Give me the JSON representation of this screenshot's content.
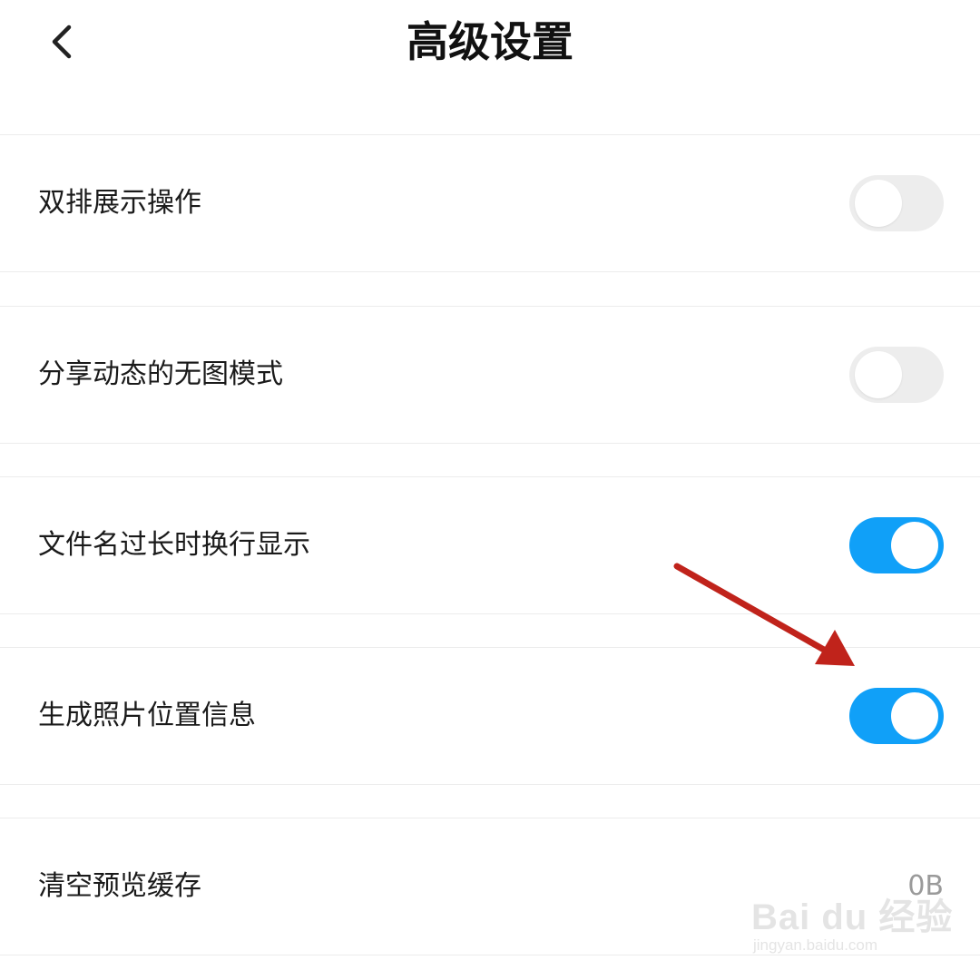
{
  "header": {
    "title": "高级设置",
    "back_icon": "chevron-left-icon"
  },
  "settings": [
    {
      "label": "双排展示操作",
      "type": "toggle",
      "state": "off"
    },
    {
      "label": "分享动态的无图模式",
      "type": "toggle",
      "state": "off"
    },
    {
      "label": "文件名过长时换行显示",
      "type": "toggle",
      "state": "on"
    },
    {
      "label": "生成照片位置信息",
      "type": "toggle",
      "state": "on"
    },
    {
      "label": "清空预览缓存",
      "type": "value",
      "value": "0B"
    }
  ],
  "colors": {
    "toggle_on": "#10a0f8",
    "toggle_off": "#ededed",
    "annotation_arrow": "#c0231b"
  },
  "watermark": {
    "brand": "Bai du 经验",
    "url": "jingyan.baidu.com"
  }
}
